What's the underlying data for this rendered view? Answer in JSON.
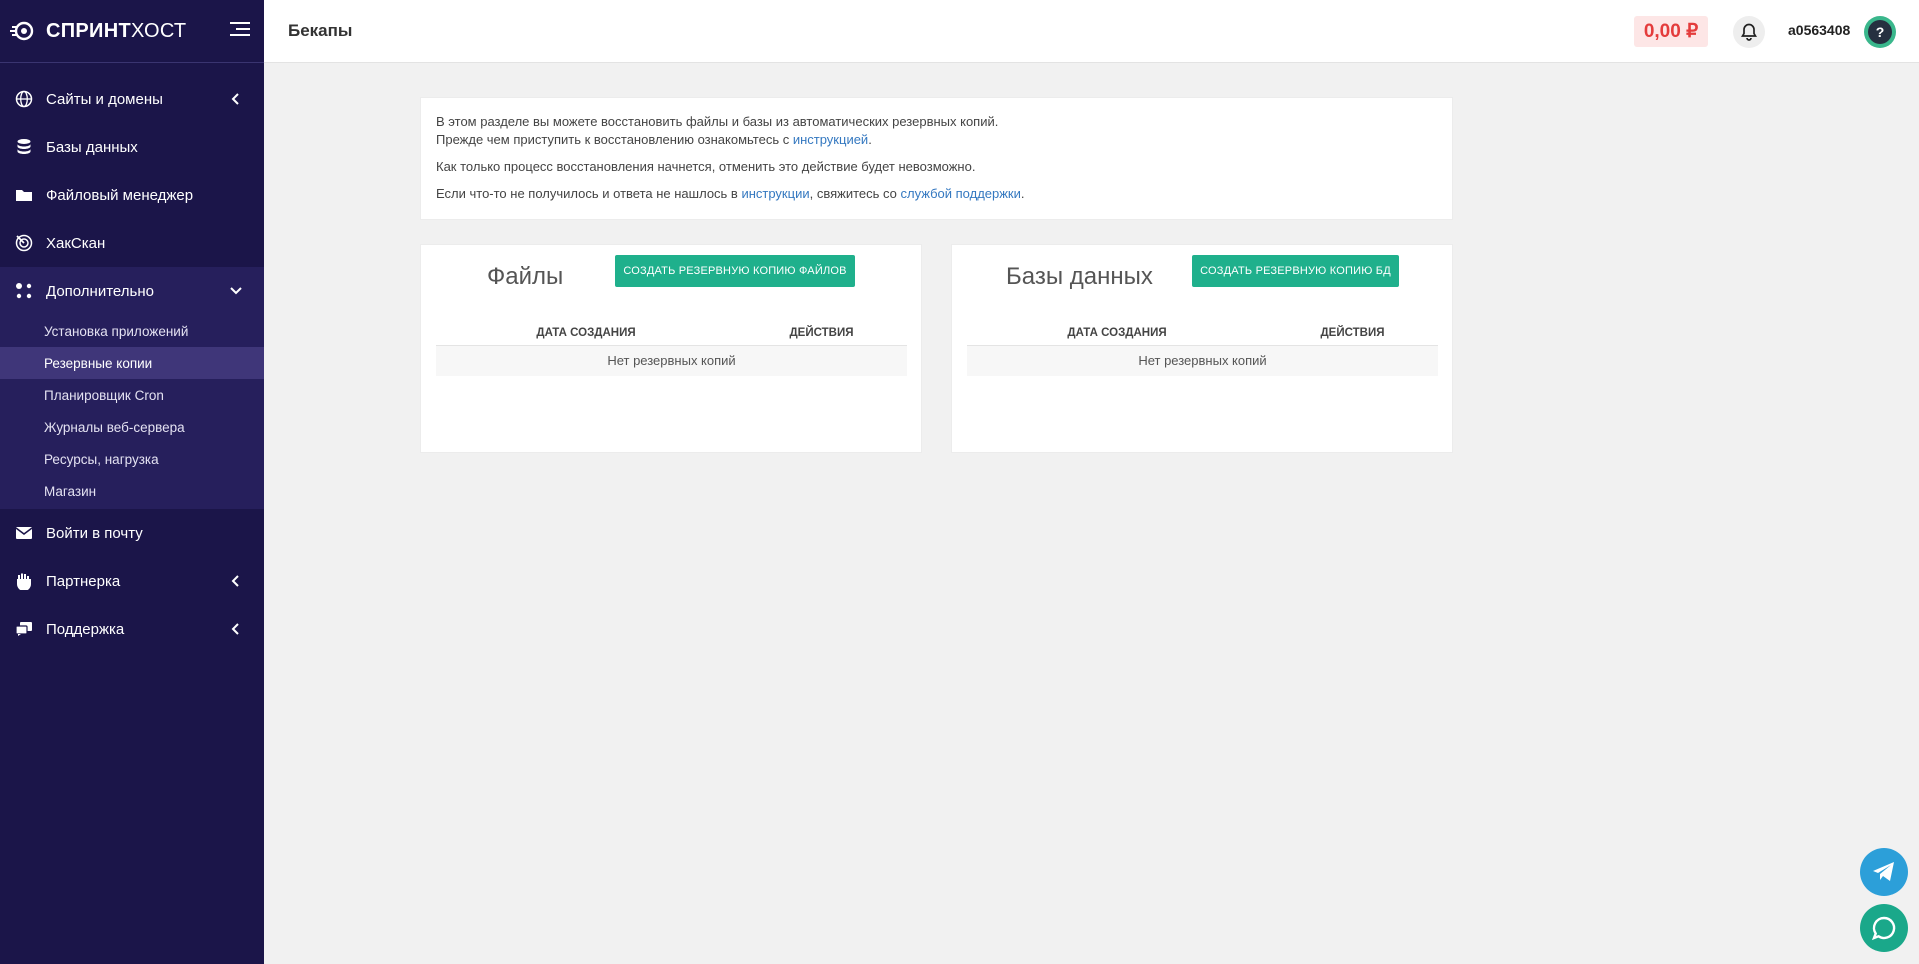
{
  "brand": {
    "name_bold": "СПРИНТ",
    "name_rest": "ХОСТ"
  },
  "header": {
    "title": "Бекапы",
    "balance": "0,00 ₽",
    "username": "a0563408",
    "avatar_label": "?"
  },
  "sidebar": {
    "items": [
      {
        "label": "Сайты и домены",
        "icon": "globe-icon",
        "chevron": "left"
      },
      {
        "label": "Базы данных",
        "icon": "database-icon"
      },
      {
        "label": "Файловый менеджер",
        "icon": "folder-icon"
      },
      {
        "label": "ХакСкан",
        "icon": "scan-icon"
      },
      {
        "label": "Дополнительно",
        "icon": "apps-icon",
        "chevron": "down"
      },
      {
        "label": "Войти в почту",
        "icon": "mail-icon"
      },
      {
        "label": "Партнерка",
        "icon": "handshake-icon",
        "chevron": "left"
      },
      {
        "label": "Поддержка",
        "icon": "support-icon",
        "chevron": "left"
      }
    ],
    "submenu": [
      "Установка приложений",
      "Резервные копии",
      "Планировщик Cron",
      "Журналы веб-сервера",
      "Ресурсы, нагрузка",
      "Магазин"
    ],
    "active_submenu": "Резервные копии"
  },
  "info": {
    "line1": "В этом разделе вы можете восстановить файлы и базы из автоматических резервных копий.",
    "line2_prefix": "Прежде чем приступить к восстановлению ознакомьтесь с ",
    "line2_link": "инструкцией",
    "line2_suffix": ".",
    "line3": "Как только процесс восстановления начнется, отменить это действие будет невозможно.",
    "line4_prefix": "Если что-то не получилось и ответа не нашлось в ",
    "line4_link1": "инструкции",
    "line4_middle": ", свяжитесь со ",
    "line4_link2": "службой поддержки",
    "line4_suffix": "."
  },
  "files_panel": {
    "title": "Файлы",
    "button": "СОЗДАТЬ РЕЗЕРВНУЮ КОПИЮ ФАЙЛОВ",
    "col_date": "ДАТА СОЗДАНИЯ",
    "col_actions": "ДЕЙСТВИЯ",
    "empty": "Нет резервных копий"
  },
  "db_panel": {
    "title": "Базы данных",
    "button": "СОЗДАТЬ РЕЗЕРВНУЮ КОПИЮ БД",
    "col_date": "ДАТА СОЗДАНИЯ",
    "col_actions": "ДЕЙСТВИЯ",
    "empty": "Нет резервных копий"
  },
  "colors": {
    "sidebar_bg": "#1b1549",
    "accent_green": "#1fb08c",
    "balance_red": "#e43c3c",
    "link_blue": "#3478c0"
  },
  "floating": {
    "telegram_icon": "telegram-icon",
    "chat_icon": "chat-icon"
  }
}
